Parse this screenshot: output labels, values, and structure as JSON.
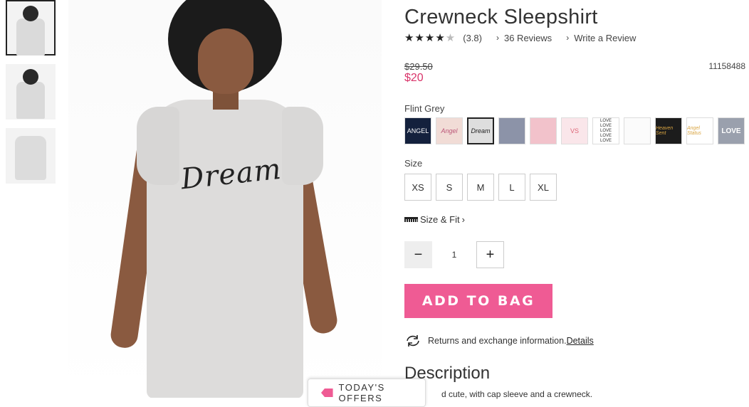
{
  "product": {
    "title": "Crewneck Sleepshirt",
    "rating_value": "(3.8)",
    "reviews_link": "36 Reviews",
    "write_review": "Write a Review",
    "old_price": "$29.50",
    "new_price": "$20",
    "sku": "11158488",
    "print_text": "Dream"
  },
  "colors": {
    "label": "Flint Grey",
    "swatches": [
      "ANGEL",
      "Angel",
      "Dream",
      "",
      "",
      "VS",
      "LOVE LOVE LOVE LOVE LOVE",
      "",
      "Heaven Sent",
      "Angel Status",
      "LOVE"
    ]
  },
  "sizes": {
    "label": "Size",
    "options": [
      "XS",
      "S",
      "M",
      "L",
      "XL"
    ]
  },
  "fit": {
    "label": "Size & Fit",
    "chevron": "›"
  },
  "quantity": {
    "minus": "−",
    "value": "1",
    "plus": "+"
  },
  "cta": {
    "add_to_bag": "ADD TO BAG"
  },
  "returns": {
    "text": "Returns and exchange information.",
    "link": "Details"
  },
  "description": {
    "heading": "Description",
    "text": "d cute, with cap sleeve and a crewneck."
  },
  "offers": {
    "label": "TODAY'S OFFERS"
  },
  "theme": {
    "accent": "#ef5b94",
    "sale": "#d9346a"
  }
}
